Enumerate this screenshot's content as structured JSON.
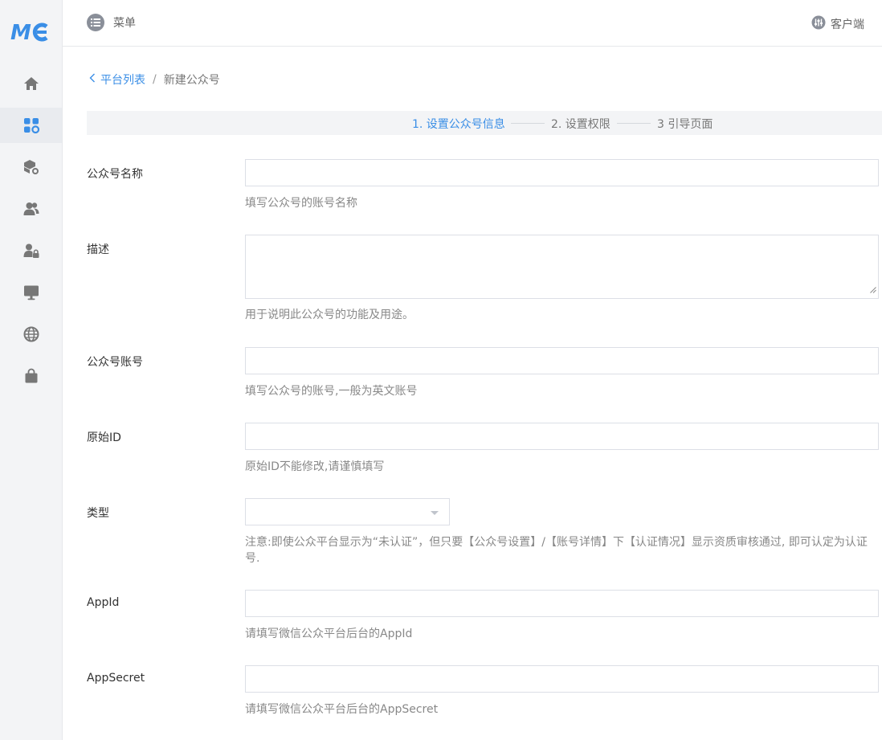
{
  "brand": {
    "logo_text": "MC",
    "accent": "#3a8ee6"
  },
  "sidebar": {
    "items": [
      {
        "icon": "home-icon",
        "active": false
      },
      {
        "icon": "apps-settings-icon",
        "active": true
      },
      {
        "icon": "box-settings-icon",
        "active": false
      },
      {
        "icon": "users-icon",
        "active": false
      },
      {
        "icon": "user-lock-icon",
        "active": false
      },
      {
        "icon": "monitor-icon",
        "active": false
      },
      {
        "icon": "globe-icon",
        "active": false
      },
      {
        "icon": "shopping-bag-icon",
        "active": false
      }
    ]
  },
  "header": {
    "menu_label": "菜单",
    "client_label": "客户端"
  },
  "breadcrumb": {
    "back_label": "平台列表",
    "separator": "/",
    "current": "新建公众号"
  },
  "steps": [
    {
      "label": "1. 设置公众号信息",
      "active": true
    },
    {
      "label": "2. 设置权限",
      "active": false
    },
    {
      "label": "3 引导页面",
      "active": false
    }
  ],
  "form": {
    "name": {
      "label": "公众号名称",
      "value": "",
      "help": "填写公众号的账号名称"
    },
    "description": {
      "label": "描述",
      "value": "",
      "help": "用于说明此公众号的功能及用途。"
    },
    "account": {
      "label": "公众号账号",
      "value": "",
      "help": "填写公众号的账号,一般为英文账号"
    },
    "original_id": {
      "label": "原始ID",
      "value": "",
      "help": "原始ID不能修改,请谨慎填写"
    },
    "type": {
      "label": "类型",
      "value": "",
      "help": "注意:即使公众平台显示为“未认证”，但只要【公众号设置】/【账号详情】下【认证情况】显示资质审核通过, 即可认定为认证号."
    },
    "app_id": {
      "label": "AppId",
      "value": "",
      "help": "请填写微信公众平台后台的AppId"
    },
    "app_secret": {
      "label": "AppSecret",
      "value": "",
      "help": "请填写微信公众平台后台的AppSecret"
    }
  }
}
